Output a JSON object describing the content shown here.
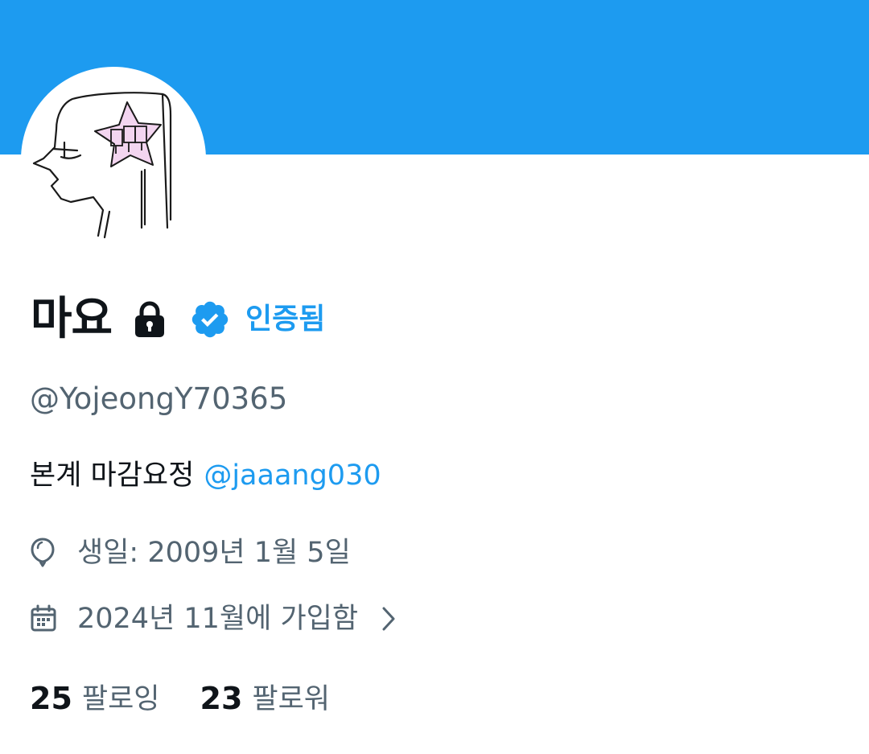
{
  "profile": {
    "display_name": "마요",
    "verified_label": "인증됨",
    "handle": "@YojeongY70365",
    "bio_text": "본계 마감요정",
    "bio_mention": "@jaaang030",
    "birthday": "생일: 2009년 1월 5일",
    "joined": "2024년 11월에 가입함",
    "following_count": "25",
    "following_label": "팔로잉",
    "followers_count": "23",
    "followers_label": "팔로워"
  },
  "colors": {
    "banner": "#1d9bf0",
    "accent": "#1d9bf0",
    "text_primary": "#0f1419",
    "text_secondary": "#536471"
  },
  "icons": {
    "lock": "lock-icon",
    "verified": "verified-badge-icon",
    "birthday": "balloon-icon",
    "joined": "calendar-icon",
    "chevron": "chevron-right-icon"
  }
}
